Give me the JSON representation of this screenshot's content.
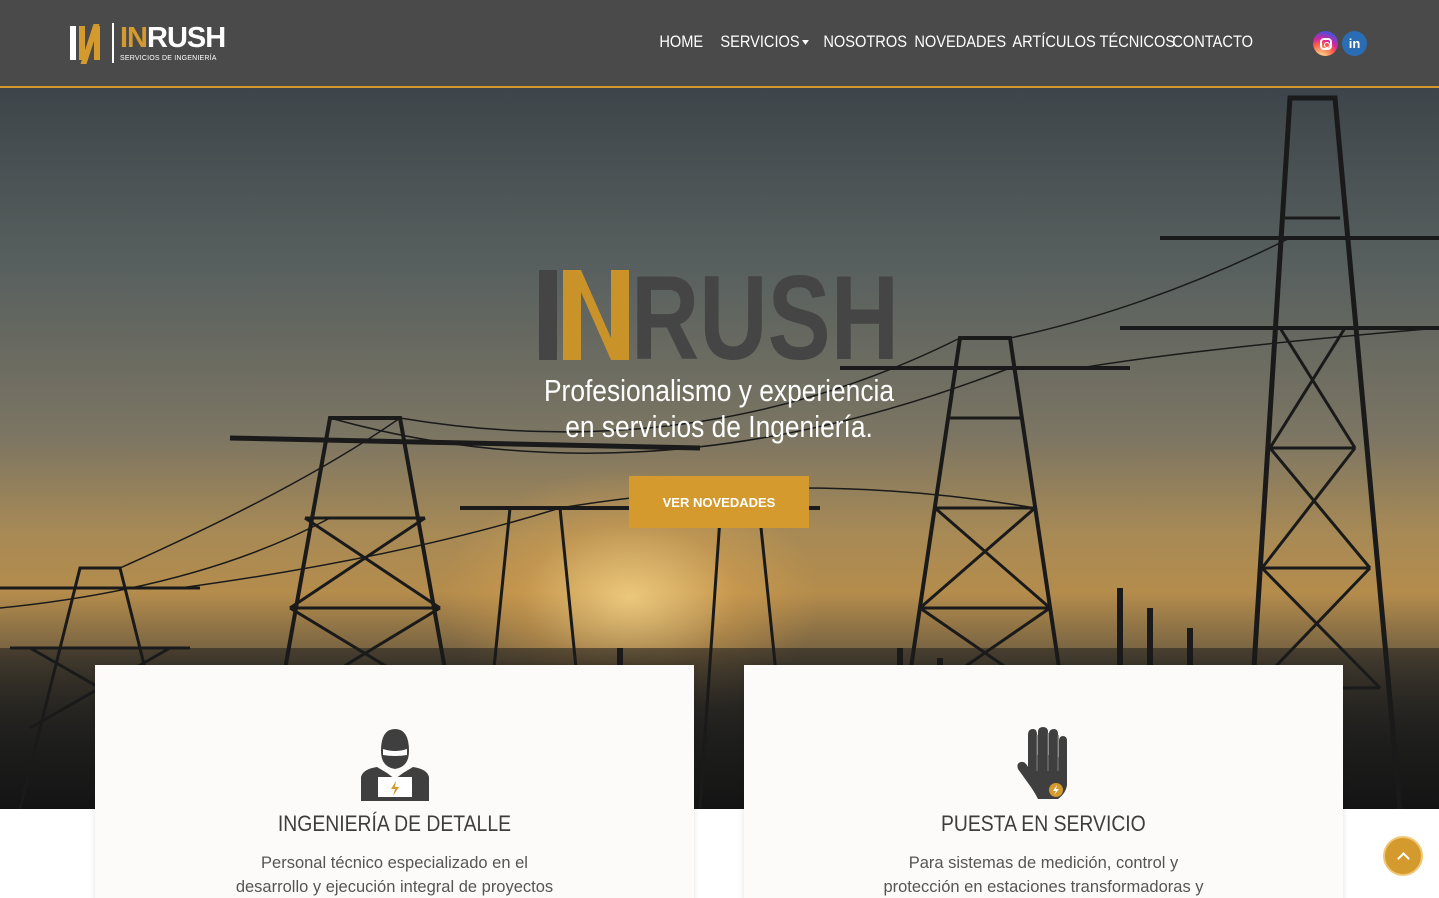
{
  "header": {
    "logo": {
      "word_left": "IN",
      "word_right": "RUSH",
      "subtitle": "SERVICIOS DE INGENIERÍA"
    },
    "nav": [
      {
        "label": "HOME"
      },
      {
        "label": "SERVICIOS",
        "has_dropdown": true
      },
      {
        "label": "NOSOTROS"
      },
      {
        "label": "NOVEDADES"
      },
      {
        "label": "ARTÍCULOS TÉCNICOS"
      },
      {
        "label": "CONTACTO"
      }
    ],
    "social": [
      {
        "icon": "instagram-icon"
      },
      {
        "icon": "linkedin-icon",
        "glyph": "in"
      }
    ]
  },
  "hero": {
    "logo_text": "INRUSH",
    "tagline_line1": "Profesionalismo y experiencia",
    "tagline_line2": "en servicios de Ingeniería.",
    "cta_label": "VER NOVEDADES"
  },
  "cards": [
    {
      "icon": "engineer-icon",
      "title": "INGENIERÍA DE DETALLE",
      "text_line1": "Personal técnico especializado en el",
      "text_line2": "desarrollo y ejecución integral de proyectos"
    },
    {
      "icon": "insulated-glove-icon",
      "title": "PUESTA EN SERVICIO",
      "text_line1": "Para sistemas de medición, control y",
      "text_line2": "protección en estaciones transformadoras y"
    }
  ],
  "colors": {
    "accent": "#d59a2d",
    "header_bg": "#4a4a4a",
    "card_bg": "#fdfbfa",
    "linkedin": "#2a6db4"
  },
  "scroll_top": {
    "icon": "chevron-up-icon"
  }
}
